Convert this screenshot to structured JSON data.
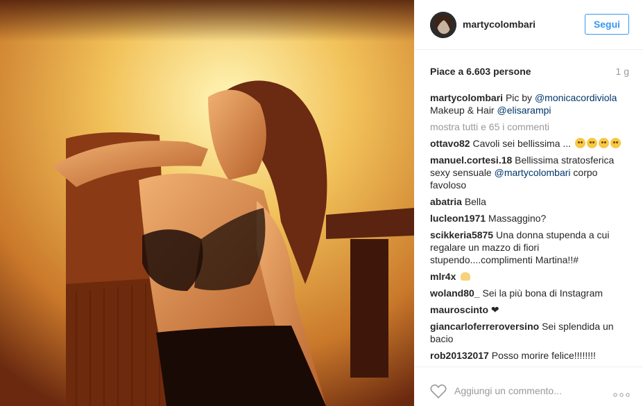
{
  "header": {
    "username": "martycolombari",
    "follow_label": "Segui"
  },
  "stats": {
    "likes": "Piace a 6.603 persone",
    "time": "1 g"
  },
  "caption": {
    "user": "martycolombari",
    "text1": "Pic by",
    "mention1": "@monicacordiviola",
    "text2": "Makeup & Hair",
    "mention2": "@elisarampi"
  },
  "view_all": "mostra tutti e 65 i commenti",
  "comments": [
    {
      "user": "ottavo82",
      "text": "Cavoli sei bellissima ...",
      "emoji": [
        "kissing-face-icon",
        "kissing-face-icon",
        "heart-eyes-face-icon",
        "heart-eyes-face-icon"
      ]
    },
    {
      "user": "manuel.cortesi.18",
      "text": "Bellissima stratosferica sexy sensuale",
      "mention": "@martycolombari",
      "text_after": "corpo favoloso"
    },
    {
      "user": "abatria",
      "text": "Bella"
    },
    {
      "user": "lucleon1971",
      "text": "Massaggino?"
    },
    {
      "user": "scikkeria5875",
      "text": "Una donna stupenda a cui regalare un mazzo di fiori stupendo....complimenti Martina!!#"
    },
    {
      "user": "mlr4x",
      "text": "",
      "emoji": [
        "raised-hand-icon"
      ]
    },
    {
      "user": "woland80_",
      "text": "Sei la più bona di Instagram"
    },
    {
      "user": "mauroscinto",
      "text": "❤"
    },
    {
      "user": "giancarloferreroversino",
      "text": "Sei splendida un bacio"
    },
    {
      "user": "rob20132017",
      "text": "Posso morire felice!!!!!!!!"
    }
  ],
  "footer": {
    "add_comment_placeholder": "Aggiungi un commento...",
    "more_icon": "more-options-icon",
    "like_icon": "heart-outline-icon"
  },
  "colors": {
    "link": "#003569",
    "follow": "#3897f0",
    "muted": "#999999"
  }
}
